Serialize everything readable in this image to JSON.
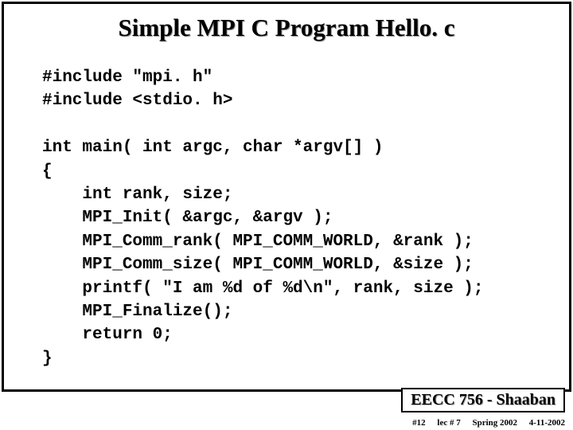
{
  "title": "Simple MPI C Program Hello. c",
  "code": {
    "line1": "#include \"mpi. h\"",
    "line2": "#include <stdio. h>",
    "line3": "",
    "line4": "int main( int argc, char *argv[] )",
    "line5": "{",
    "line6": "    int rank, size;",
    "line7": "    MPI_Init( &argc, &argv );",
    "line8": "    MPI_Comm_rank( MPI_COMM_WORLD, &rank );",
    "line9": "    MPI_Comm_size( MPI_COMM_WORLD, &size );",
    "line10": "    printf( \"I am %d of %d\\n\", rank, size );",
    "line11": "    MPI_Finalize();",
    "line12": "    return 0;",
    "line13": "}"
  },
  "footer": {
    "course": "EECC 756 - Shaaban",
    "slide_num": "#12",
    "lecture": "lec # 7",
    "term": "Spring 2002",
    "date": "4-11-2002"
  }
}
